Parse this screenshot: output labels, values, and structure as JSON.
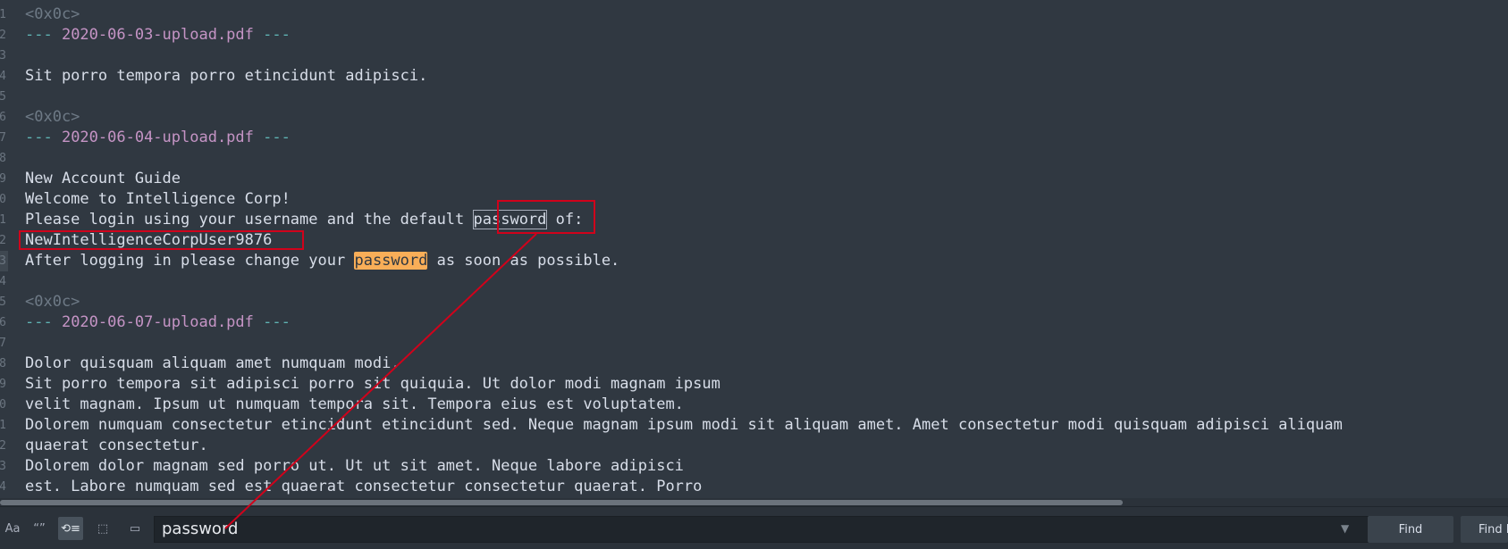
{
  "editor": {
    "lines": [
      {
        "gutter": "1",
        "segments": [
          {
            "t": "<0x0c>",
            "c": "c-ff"
          }
        ]
      },
      {
        "gutter": "2",
        "segments": [
          {
            "t": "--- ",
            "c": "c-sep"
          },
          {
            "t": "2020-06-03-upload.pdf",
            "c": "c-file"
          },
          {
            "t": " ---",
            "c": "c-sep"
          }
        ]
      },
      {
        "gutter": "3",
        "segments": []
      },
      {
        "gutter": "4",
        "segments": [
          {
            "t": "Sit porro tempora porro etincidunt adipisci."
          }
        ]
      },
      {
        "gutter": "5",
        "segments": []
      },
      {
        "gutter": "6",
        "segments": [
          {
            "t": "<0x0c>",
            "c": "c-ff"
          }
        ]
      },
      {
        "gutter": "7",
        "segments": [
          {
            "t": "--- ",
            "c": "c-sep"
          },
          {
            "t": "2020-06-04-upload.pdf",
            "c": "c-file"
          },
          {
            "t": " ---",
            "c": "c-sep"
          }
        ]
      },
      {
        "gutter": "8",
        "segments": []
      },
      {
        "gutter": "9",
        "segments": [
          {
            "t": "New Account Guide"
          }
        ]
      },
      {
        "gutter": "0",
        "segments": [
          {
            "t": "Welcome to Intelligence Corp!"
          }
        ]
      },
      {
        "gutter": "1",
        "segments": [
          {
            "t": "Please login using your username and the default "
          },
          {
            "t": "password",
            "c": "hl-cur"
          },
          {
            "t": " of:"
          }
        ]
      },
      {
        "gutter": "2",
        "segments": [
          {
            "t": "NewIntelligenceCorpUser9876"
          }
        ]
      },
      {
        "gutter": "3",
        "active": true,
        "segments": [
          {
            "t": "After logging in please change your "
          },
          {
            "t": "password",
            "c": "hl-match"
          },
          {
            "t": " as soon as possible."
          }
        ]
      },
      {
        "gutter": "4",
        "segments": []
      },
      {
        "gutter": "5",
        "segments": [
          {
            "t": "<0x0c>",
            "c": "c-ff"
          }
        ]
      },
      {
        "gutter": "6",
        "segments": [
          {
            "t": "--- ",
            "c": "c-sep"
          },
          {
            "t": "2020-06-07-upload.pdf",
            "c": "c-file"
          },
          {
            "t": " ---",
            "c": "c-sep"
          }
        ]
      },
      {
        "gutter": "7",
        "segments": []
      },
      {
        "gutter": "8",
        "segments": [
          {
            "t": "Dolor quisquam aliquam amet numquam modi."
          }
        ]
      },
      {
        "gutter": "9",
        "segments": [
          {
            "t": "Sit porro tempora sit adipisci porro sit quiquia. Ut dolor modi magnam ipsum"
          }
        ]
      },
      {
        "gutter": "0",
        "segments": [
          {
            "t": "velit magnam. Ipsum ut numquam tempora sit. Tempora eius est voluptatem."
          }
        ]
      },
      {
        "gutter": "1",
        "segments": [
          {
            "t": "Dolorem numquam consectetur etincidunt etincidunt sed. Neque magnam ipsum modi sit aliquam amet. Amet consectetur modi quisquam adipisci aliquam"
          }
        ]
      },
      {
        "gutter": "2",
        "segments": [
          {
            "t": "quaerat consectetur."
          }
        ]
      },
      {
        "gutter": "3",
        "segments": [
          {
            "t": "Dolorem dolor magnam sed porro ut. Ut ut sit amet. Neque labore adipisci"
          }
        ]
      },
      {
        "gutter": "4",
        "segments": [
          {
            "t": "est. Labore numquam sed est quaerat consectetur consectetur quaerat. Porro"
          }
        ]
      }
    ]
  },
  "findbar": {
    "options": [
      {
        "label": "Aa",
        "name": "case-sensitive-toggle",
        "on": false
      },
      {
        "label": "“”",
        "name": "whole-word-toggle",
        "on": false
      },
      {
        "label": "⟲≡",
        "name": "wrap-toggle",
        "on": true
      },
      {
        "label": "⬚",
        "name": "in-selection-toggle",
        "on": false
      },
      {
        "label": "▭",
        "name": "highlight-matches-toggle",
        "on": false
      }
    ],
    "query": "password",
    "dropdown_icon": "▼",
    "find_label": "Find",
    "find_prev_label": "Find Prev"
  },
  "colors": {
    "background": "#303841",
    "annotation": "#d0021b",
    "match_highlight": "#f9ae58"
  }
}
